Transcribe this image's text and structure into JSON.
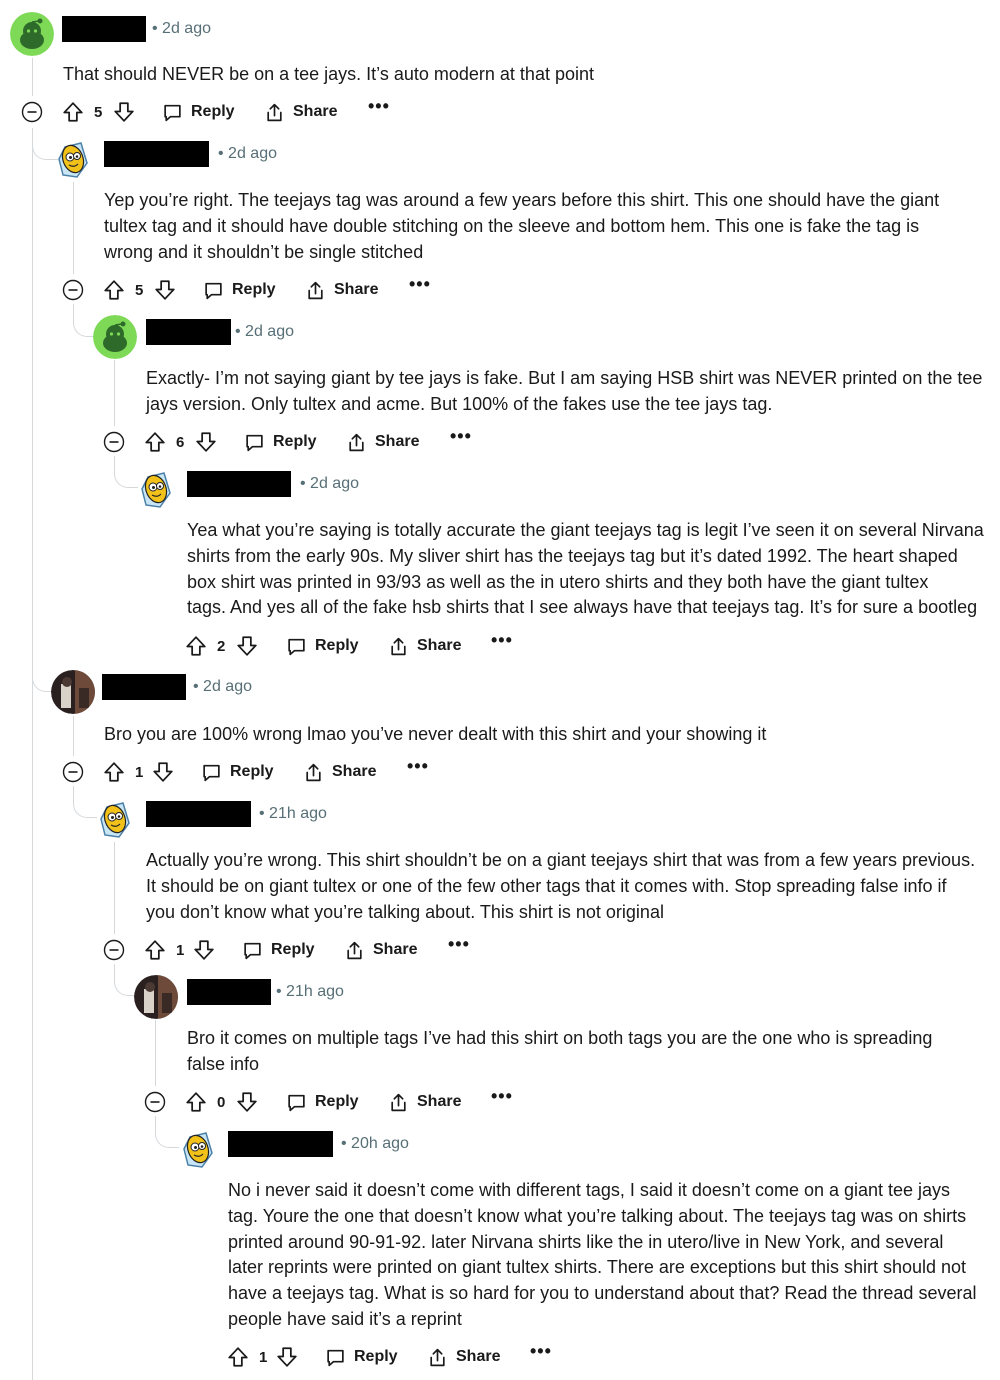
{
  "comments": [
    {
      "time": "• 2d ago",
      "avatar": "snoo-green-avatar",
      "text": "That should NEVER be on a tee jays. It’s auto modern at that point",
      "score": "5",
      "reply": "Reply",
      "share": "Share",
      "more": "•••"
    },
    {
      "time": "• 2d ago",
      "avatar": "corn-cob-avatar",
      "text": "Yep you’re right. The teejays tag was around a few years before this shirt. This one should have the giant\ntultex tag and it should have double stitching on the sleeve and bottom hem. This one is fake the tag is\nwrong and it shouldn’t be single stitched",
      "score": "5",
      "reply": "Reply",
      "share": "Share",
      "more": "•••"
    },
    {
      "time": "• 2d ago",
      "avatar": "snoo-green-avatar",
      "text": "Exactly- I’m not saying giant by tee jays is fake. But I am saying HSB shirt was NEVER printed on the tee\njays version. Only tultex and acme. But 100% of the fakes use the tee jays tag.",
      "score": "6",
      "reply": "Reply",
      "share": "Share",
      "more": "•••"
    },
    {
      "time": "• 2d ago",
      "avatar": "corn-cob-avatar",
      "text": "Yea what you’re saying is totally accurate the giant teejays tag is legit I’ve seen it on several Nirvana\nshirts from the early 90s. My sliver shirt has the teejays tag but it’s dated 1992. The heart shaped\nbox shirt was printed in 93/93 as well as the in utero shirts and they both have the giant tultex\ntags. And yes all of the fake hsb shirts that I see always have that teejays tag. It’s for sure a bootleg",
      "score": "2",
      "reply": "Reply",
      "share": "Share",
      "more": "•••"
    },
    {
      "time": "• 2d ago",
      "avatar": "photo-avatar",
      "text": "Bro you are 100% wrong lmao you’ve never dealt with this shirt and your showing it",
      "score": "1",
      "reply": "Reply",
      "share": "Share",
      "more": "•••"
    },
    {
      "time": "• 21h ago",
      "avatar": "corn-cob-avatar",
      "text": "Actually you’re wrong. This shirt shouldn’t be on a giant teejays shirt that was from a few years previous.\nIt should be on giant tultex or one of the few other tags that it comes with. Stop spreading false info if\nyou don’t know what you’re talking about. This shirt is not original",
      "score": "1",
      "reply": "Reply",
      "share": "Share",
      "more": "•••"
    },
    {
      "time": "• 21h ago",
      "avatar": "photo-avatar",
      "text": "Bro it comes on multiple tags I’ve had this shirt on both tags you are the one who is spreading\nfalse info",
      "score": "0",
      "reply": "Reply",
      "share": "Share",
      "more": "•••"
    },
    {
      "time": "• 20h ago",
      "avatar": "corn-cob-avatar",
      "text": "No i never said it doesn’t come with different tags, I said it doesn’t come on a giant tee jays\ntag. Youre the one that doesn’t know what you’re talking about. The teejays tag was on shirts\nprinted around 90-91-92. later Nirvana shirts like the in utero/live in New York, and several\nlater reprints were printed on giant tultex shirts. There are exceptions but this shirt should not\nhave a teejays tag. What is so hard for you to understand about that? Read the thread several\npeople have said it’s a reprint",
      "score": "1",
      "reply": "Reply",
      "share": "Share",
      "more": "•••"
    }
  ]
}
